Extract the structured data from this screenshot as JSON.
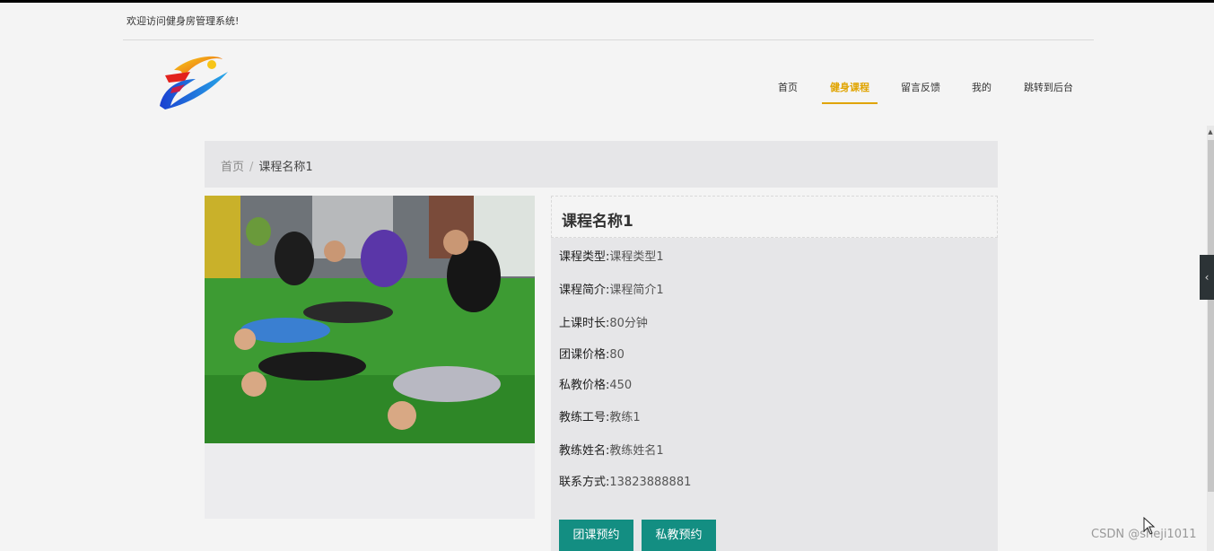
{
  "header": {
    "welcome_text": "欢迎访问健身房管理系统!"
  },
  "nav": {
    "items": [
      {
        "label": "首页",
        "active": false
      },
      {
        "label": "健身课程",
        "active": true
      },
      {
        "label": "留言反馈",
        "active": false
      },
      {
        "label": "我的",
        "active": false
      },
      {
        "label": "跳转到后台",
        "active": false
      }
    ]
  },
  "breadcrumb": {
    "home": "首页",
    "separator": "/",
    "current": "课程名称1"
  },
  "course": {
    "title": "课程名称1",
    "fields": [
      {
        "label": "课程类型:",
        "value": "课程类型1"
      },
      {
        "label": "课程简介:",
        "value": "课程简介1"
      },
      {
        "label": "上课时长:",
        "value": "80分钟"
      },
      {
        "label": "团课价格:",
        "value": "80"
      },
      {
        "label": "私教价格:",
        "value": "450"
      },
      {
        "label": "教练工号:",
        "value": "教练1"
      },
      {
        "label": "教练姓名:",
        "value": "教练姓名1"
      },
      {
        "label": "联系方式:",
        "value": "13823888881"
      }
    ],
    "buttons": {
      "group_booking": "团课预约",
      "private_booking": "私教预约"
    }
  },
  "watermark": "CSDN @sheji1011",
  "colors": {
    "accent": "#e0a400",
    "button": "#138e82",
    "panel": "#e6e6e8"
  }
}
